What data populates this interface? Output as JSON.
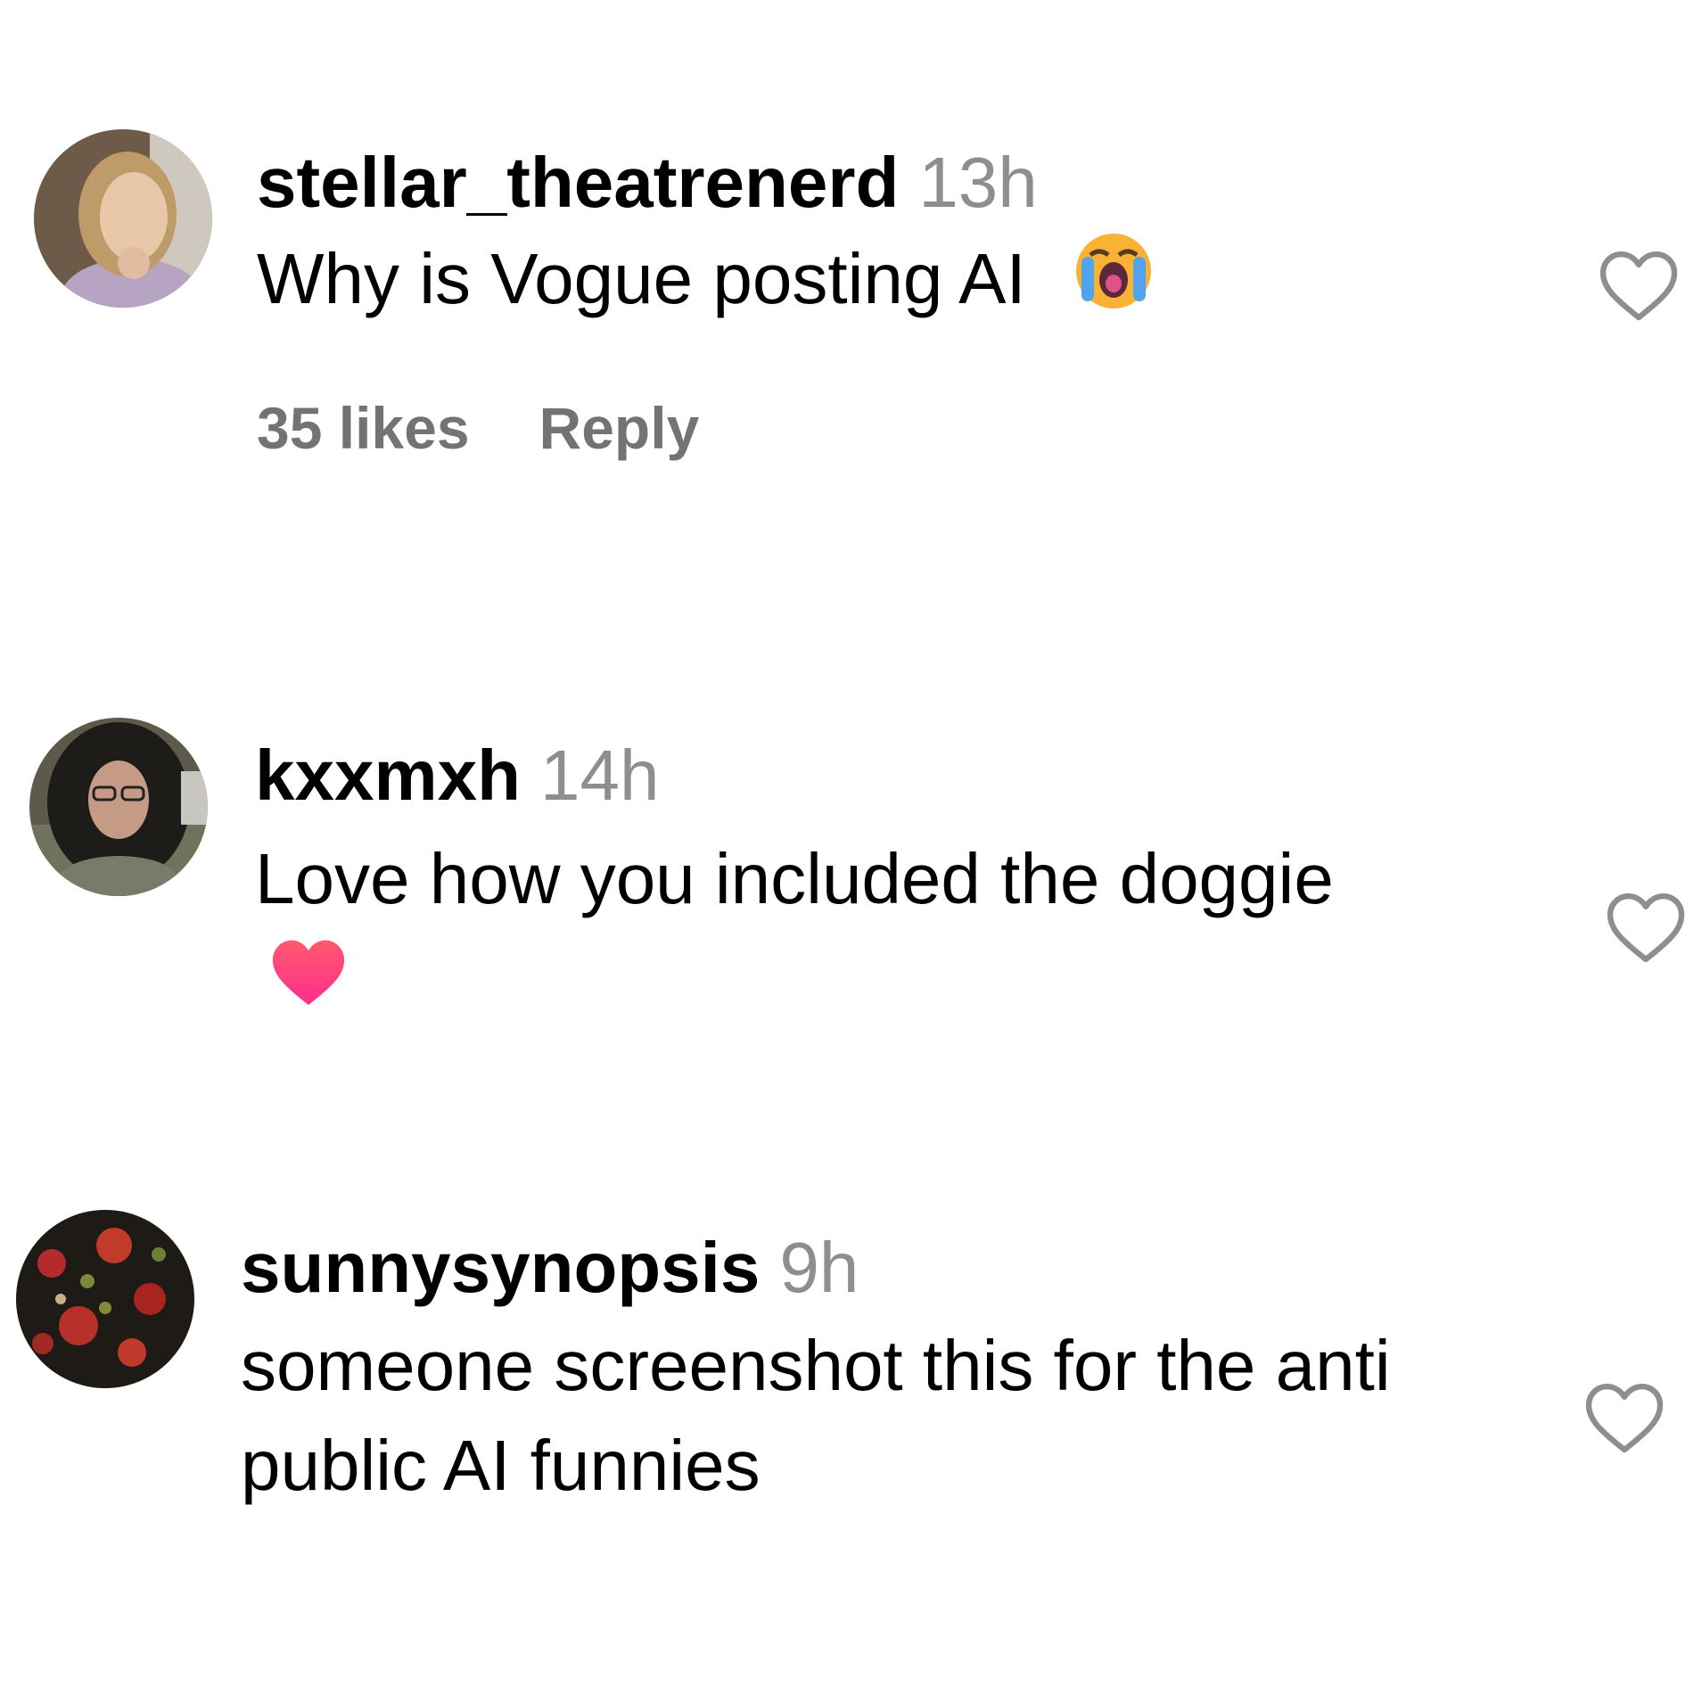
{
  "comments": [
    {
      "username": "stellar_theatrenerd",
      "time": "13h",
      "text": "Why is Vogue posting AI",
      "emoji_icon": "loudly-crying-face-icon",
      "likes": "35 likes",
      "reply_label": "Reply"
    },
    {
      "username": "kxxmxh",
      "time": "14h",
      "text": "Love how you included the doggie",
      "emoji_icon": "red-heart-icon"
    },
    {
      "username": "sunnysynopsis",
      "time": "9h",
      "text_lines": [
        "someone screenshot this for the anti",
        "public AI funnies"
      ]
    }
  ],
  "like_icon": "heart-outline-icon",
  "colors": {
    "text": "#000000",
    "secondary": "#8e8e8e",
    "action": "#737373",
    "heart_stroke": "#8e8e8e"
  }
}
